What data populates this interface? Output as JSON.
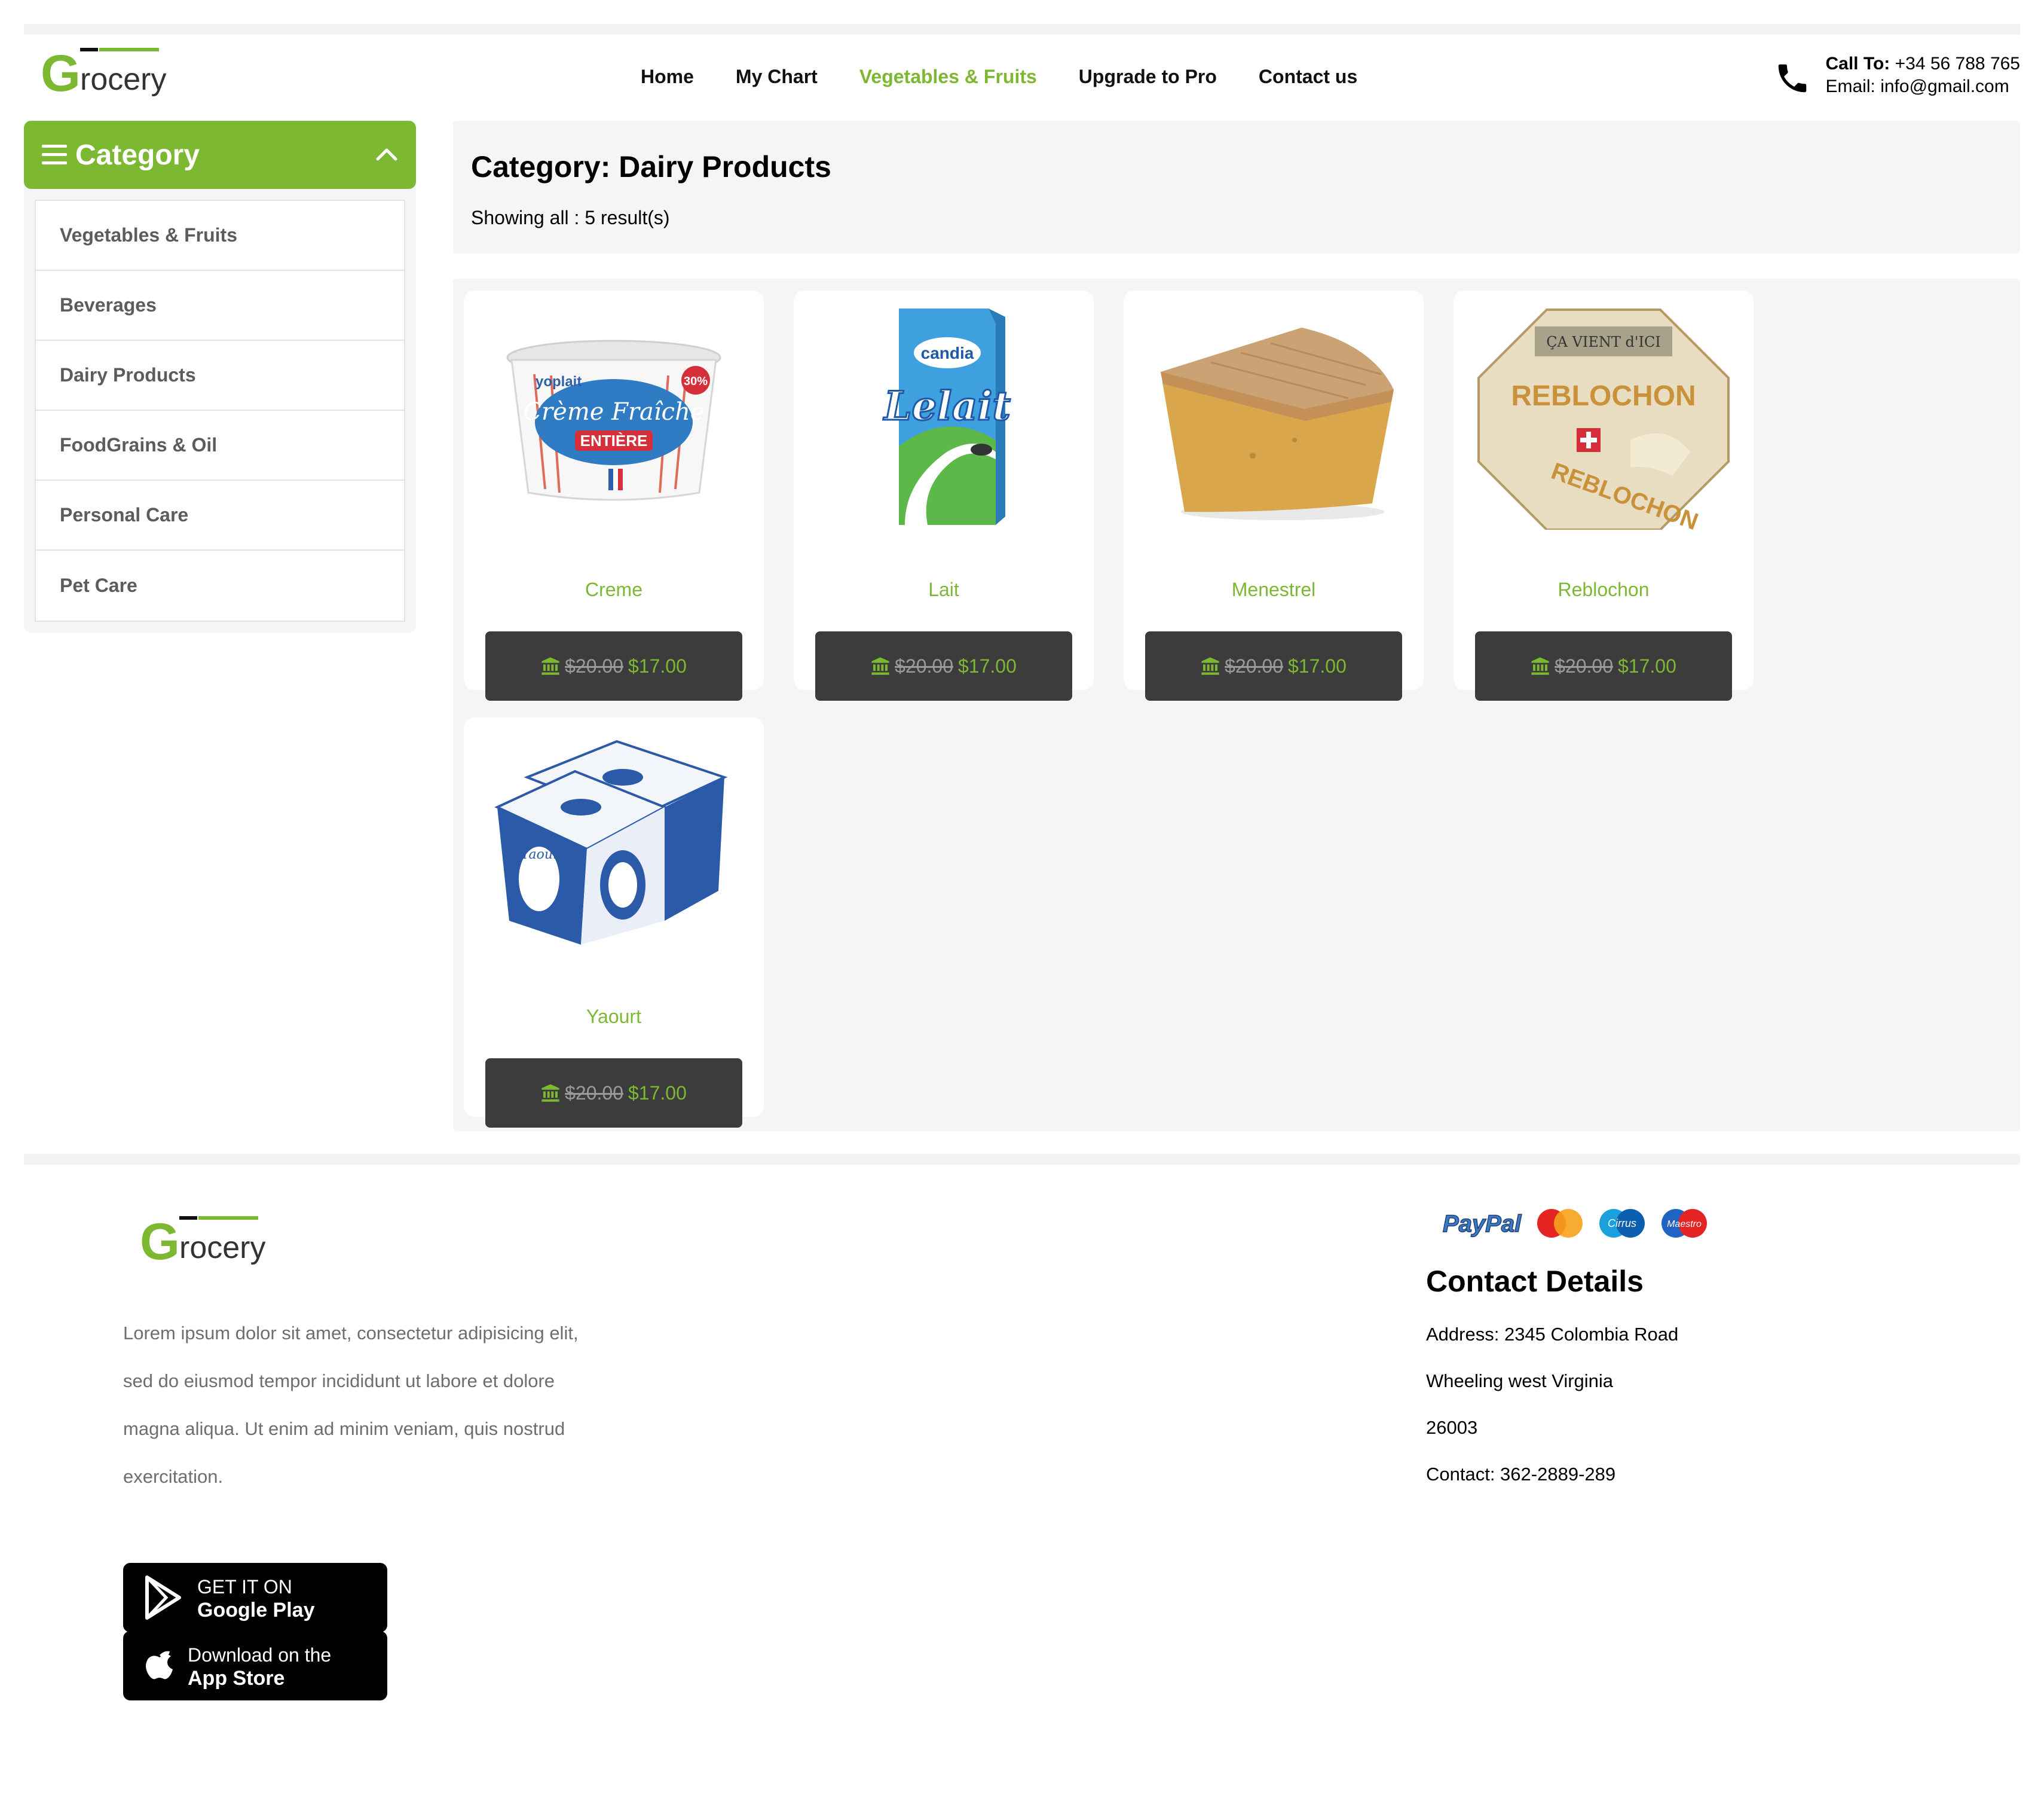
{
  "brand": {
    "logo_text": "Grocery",
    "accent_color": "#7cb832",
    "dark_button_color": "#3c3c3c"
  },
  "nav": {
    "items": [
      "Home",
      "My Chart",
      "Vegetables & Fruits",
      "Upgrade to Pro",
      "Contact us"
    ],
    "active": "Vegetables & Fruits"
  },
  "header_contact": {
    "call_label": "Call To:",
    "call_value": "+34 56 788 765",
    "email_label": "Email:",
    "email_value": "info@gmail.com",
    "icon": "phone-icon"
  },
  "sidebar": {
    "title": "Category",
    "items": [
      "Vegetables & Fruits",
      "Beverages",
      "Dairy Products",
      "FoodGrains & Oil",
      "Personal Care",
      "Pet Care"
    ]
  },
  "main": {
    "category_title": "Category: Dairy Products",
    "results_text": "Showing all : 5 result(s)"
  },
  "products": [
    {
      "name": "Creme",
      "old_price": "$20.00",
      "new_price": "$17.00"
    },
    {
      "name": "Lait",
      "old_price": "$20.00",
      "new_price": "$17.00"
    },
    {
      "name": "Menestrel",
      "old_price": "$20.00",
      "new_price": "$17.00"
    },
    {
      "name": "Reblochon",
      "old_price": "$20.00",
      "new_price": "$17.00"
    },
    {
      "name": "Yaourt",
      "old_price": "$20.00",
      "new_price": "$17.00"
    }
  ],
  "footer": {
    "about_lines": [
      "Lorem ipsum dolor sit amet, consectetur adipisicing elit,",
      "sed do eiusmod tempor incididunt ut labore et dolore",
      "magna aliqua. Ut enim ad minim veniam, quis nostrud",
      "exercitation."
    ],
    "google_play": {
      "line1": "GET IT ON",
      "line2": "Google Play"
    },
    "app_store": {
      "line1": "Download on the",
      "line2": "App Store"
    },
    "payment_methods": [
      "PayPal",
      "MasterCard",
      "Cirrus",
      "Maestro"
    ],
    "contact_title": "Contact Details",
    "contact_lines": [
      "Address: 2345 Colombia Road",
      "Wheeling west Virginia",
      "26003",
      "Contact: 362-2889-289"
    ]
  }
}
